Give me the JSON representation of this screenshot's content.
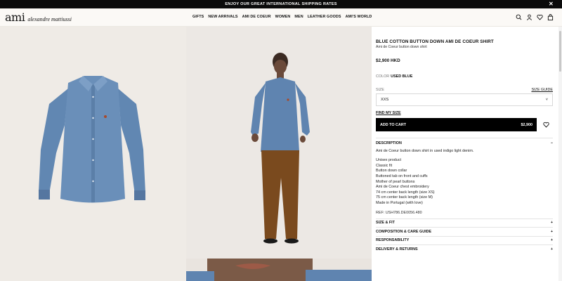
{
  "banner": {
    "text": "ENJOY OUR GREAT INTERNATIONAL SHIPPING RATES",
    "close_icon": "close-icon"
  },
  "header": {
    "logo_mark": "ami",
    "logo_word": "alexandre mattiussi",
    "nav": [
      "GIFTS",
      "NEW ARRIVALS",
      "AMI DE COEUR",
      "WOMEN",
      "MEN",
      "LEATHER GOODS",
      "AMI'S WORLD"
    ],
    "icons": [
      "search-icon",
      "user-icon",
      "heart-icon",
      "bag-icon"
    ]
  },
  "product": {
    "title": "BLUE COTTON BUTTON DOWN AMI DE COEUR SHIRT",
    "subtitle": "Ami de Coeur button down shirt",
    "price": "$2,900 HKD",
    "color_label": "COLOR",
    "color_value": "USED BLUE",
    "size_label": "SIZE",
    "size_guide": "SIZE GUIDE",
    "size_selected": "XXS",
    "find_size": "FIND MY SIZE",
    "add_to_cart": "ADD TO CART",
    "cart_price": "$2,900",
    "description_title": "DESCRIPTION",
    "description_text": "Ami de Coeur button down shirt in used indigo light denim.",
    "features": [
      "Unisex product",
      "Classic fit",
      "Button down collar",
      "Buttoned tab on front and cuffs",
      "Mother of pearl buttons",
      "Ami de Coeur chest embroidery",
      "74 cm center back length (size XS)",
      "75 cm center back length (size M)",
      "Made in Portugal (with love)"
    ],
    "ref": "REF: USH786.DE0056.480",
    "accordions": [
      "SIZE & FIT",
      "COMPOSITION & CARE GUIDE",
      "RESPONSABILITY",
      "DELIVERY & RETURNS"
    ],
    "accordion_symbol": "+",
    "collapse_symbol": "−",
    "chevron": "˅"
  },
  "colors": {
    "black": "#000000",
    "shirt_blue": "#5b7fa8",
    "trouser_brown": "#7a4a1e",
    "bg_beige": "#efebe6"
  }
}
